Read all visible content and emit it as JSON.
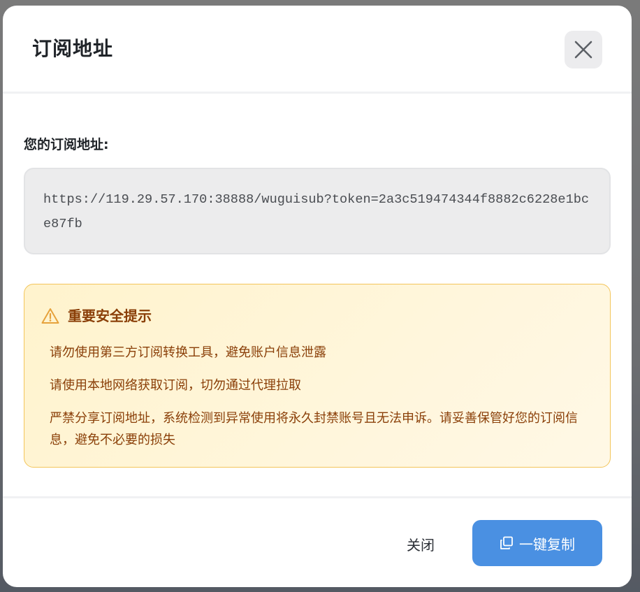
{
  "modal": {
    "title": "订阅地址",
    "close_icon": "close-icon"
  },
  "subscription": {
    "label": "您的订阅地址:",
    "url": "https://119.29.57.170:38888/wuguisub?token=2a3c519474344f8882c6228e1bce87fb"
  },
  "warning": {
    "icon": "warning-triangle-icon",
    "title": "重要安全提示",
    "items": [
      "请勿使用第三方订阅转换工具，避免账户信息泄露",
      "请使用本地网络获取订阅，切勿通过代理拉取",
      "严禁分享订阅地址，系统检测到异常使用将永久封禁账号且无法申诉。请妥善保管好您的订阅信息，避免不必要的损失"
    ]
  },
  "footer": {
    "cancel_label": "关闭",
    "copy_label": "一键复制",
    "copy_icon": "copy-icon"
  },
  "colors": {
    "primary": "#4a90e2",
    "warning_text": "#8a3f08",
    "warning_border": "#f3c55a",
    "warning_icon": "#e6a23c",
    "warning_bg": "#fff3cd"
  }
}
